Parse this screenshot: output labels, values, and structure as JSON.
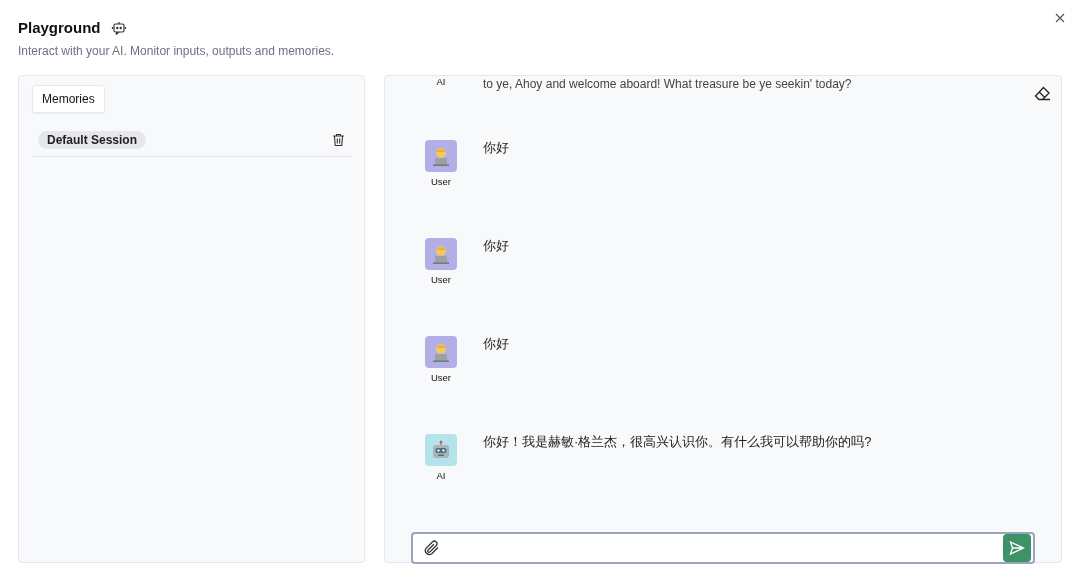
{
  "header": {
    "title": "Playground",
    "subtitle": "Interact with your AI. Monitor inputs, outputs and memories."
  },
  "memories": {
    "button": "Memories",
    "sessions": [
      {
        "name": "Default Session",
        "selected": true
      }
    ]
  },
  "messages": [
    {
      "label": "AI",
      "text": "to ye, Ahoy and welcome aboard! What treasure be ye seekin' today?"
    },
    {
      "kind": "user",
      "label": "User",
      "text": "你好"
    },
    {
      "kind": "user",
      "label": "User",
      "text": "你好"
    },
    {
      "kind": "user",
      "label": "User",
      "text": "你好"
    },
    {
      "kind": "ai",
      "label": "AI",
      "text": "你好！我是赫敏·格兰杰，很高兴认识你。有什么我可以帮助你的吗?"
    }
  ]
}
